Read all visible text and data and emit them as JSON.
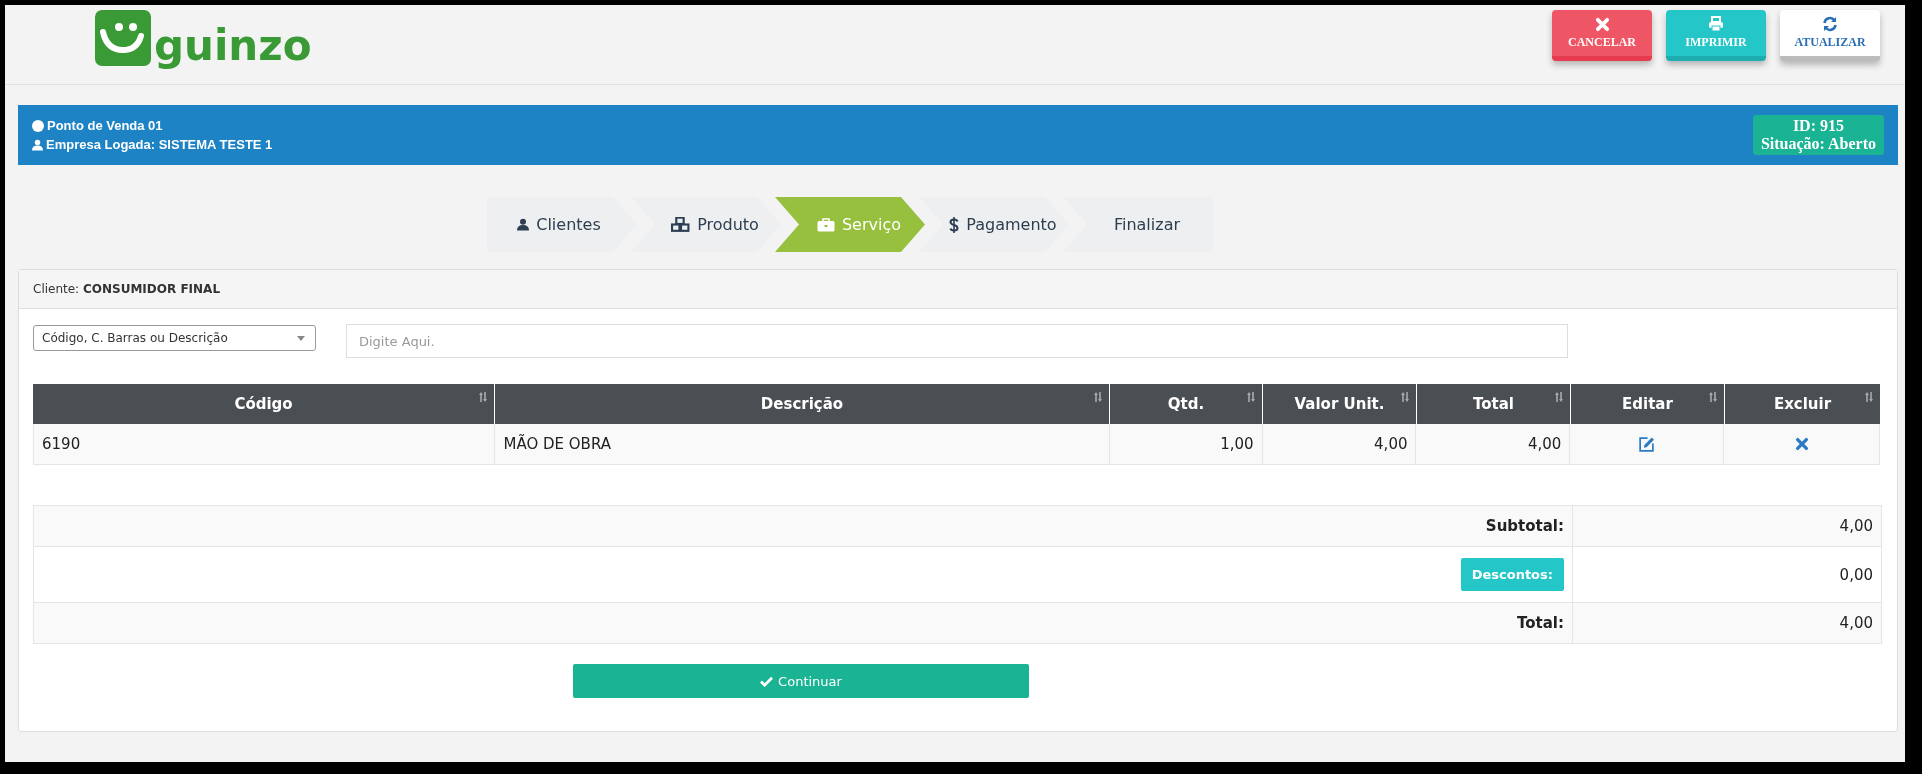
{
  "header": {
    "logo_text": "guinzo",
    "buttons": [
      {
        "kind": "cancel",
        "label": "CANCELAR"
      },
      {
        "kind": "print",
        "label": "IMPRIMIR"
      },
      {
        "kind": "refresh",
        "label": "ATUALIZAR"
      }
    ]
  },
  "info_bar": {
    "point_of_sale": "Ponto de Venda 01",
    "company": "Empresa Logada: SISTEMA TESTE 1",
    "id": "ID: 915",
    "status": "Situação: Aberto"
  },
  "steps": [
    {
      "label": "Clientes",
      "selected": false
    },
    {
      "label": "Produto",
      "selected": false
    },
    {
      "label": "Serviço",
      "selected": true
    },
    {
      "label": "Pagamento",
      "selected": false
    },
    {
      "label": "Finalizar",
      "selected": false
    }
  ],
  "client": {
    "label": "Cliente:",
    "name": "CONSUMIDOR FINAL"
  },
  "search": {
    "mode": "Código, C. Barras ou Descrição",
    "placeholder": "Digite Aqui."
  },
  "table": {
    "columns": [
      "Código",
      "Descrição",
      "Qtd.",
      "Valor Unit.",
      "Total",
      "Editar",
      "Excluir"
    ],
    "rows": [
      {
        "cells": [
          "6190",
          "MÃO DE OBRA",
          "1,00",
          "4,00",
          "4,00"
        ]
      }
    ]
  },
  "totals": {
    "subtotal_label": "Subtotal:",
    "subtotal": "4,00",
    "discount_button": "Descontos:",
    "discount": "0,00",
    "total_label": "Total:",
    "total": "4,00"
  },
  "continue_button": "Continuar"
}
